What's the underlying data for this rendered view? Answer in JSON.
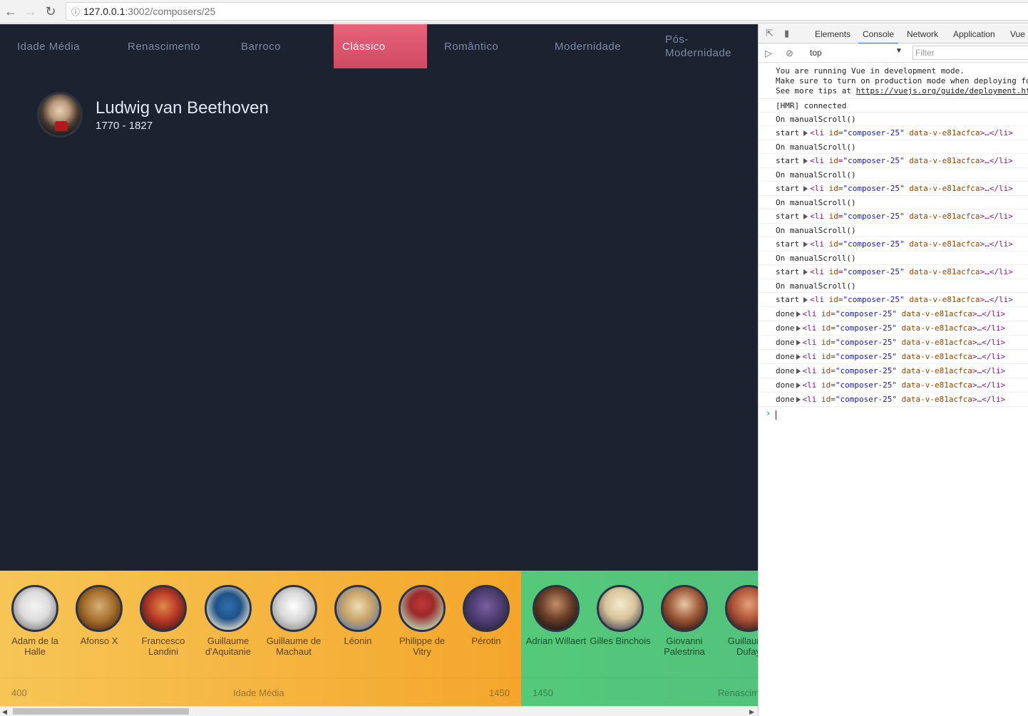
{
  "browser": {
    "url_host": "127.0.0.1",
    "url_path": ":3002/composers/25",
    "back_icon": "arrow-left-icon",
    "forward_icon": "arrow-right-icon",
    "reload_icon": "reload-icon",
    "info_icon": "info-icon"
  },
  "nav": {
    "periods": [
      {
        "label": "Idade Média"
      },
      {
        "label": "Renascimento"
      },
      {
        "label": "Barroco"
      },
      {
        "label": "Clássico",
        "active": true
      },
      {
        "label": "Romântico"
      },
      {
        "label": "Modernidade"
      },
      {
        "label": "Pós-Modernidade"
      }
    ],
    "active_color": "#d9566d"
  },
  "composer": {
    "name": "Ludwig van Beethoven",
    "years": "1770 - 1827"
  },
  "timeline": {
    "eras": [
      {
        "name": "Idade Média",
        "start": "400",
        "end": "1450",
        "color_from": "#f6c556",
        "color_to": "#f4a62b",
        "composers": [
          {
            "name": "Adam de la Halle"
          },
          {
            "name": "Afonso X"
          },
          {
            "name": "Francesco Landini"
          },
          {
            "name": "Guillaume d'Aquitanie"
          },
          {
            "name": "Guillaume de Machaut"
          },
          {
            "name": "Léonin"
          },
          {
            "name": "Philippe de Vitry"
          },
          {
            "name": "Pérotin"
          }
        ]
      },
      {
        "name": "Renascimento",
        "start": "1450",
        "color_from": "#55c97a",
        "color_to": "#53c27d",
        "composers": [
          {
            "name": "Adrian Willaert"
          },
          {
            "name": "Gilles Binchois"
          },
          {
            "name": "Giovanni Palestrina"
          },
          {
            "name": "Guillaume Dufay"
          }
        ]
      }
    ]
  },
  "devtools": {
    "tabs": [
      "Elements",
      "Console",
      "Network",
      "Application",
      "Vue"
    ],
    "active_tab": "Console",
    "context": "top",
    "filter_placeholder": "Filter",
    "messages": [
      {
        "type": "multiline",
        "lines": [
          "You are running Vue in development mode.",
          "Make sure to turn on production mode when deploying fo",
          "See more tips at "
        ],
        "link": "https://vuejs.org/guide/deployment.ht"
      },
      {
        "type": "text",
        "text": "[HMR] connected"
      },
      {
        "type": "text",
        "text": "On manualScroll()"
      },
      {
        "type": "el",
        "prefix": "start",
        "attr_id": "composer-25",
        "attr_data": "data-v-e81acfca"
      },
      {
        "type": "text",
        "text": "On manualScroll()"
      },
      {
        "type": "el",
        "prefix": "start",
        "attr_id": "composer-25",
        "attr_data": "data-v-e81acfca"
      },
      {
        "type": "text",
        "text": "On manualScroll()"
      },
      {
        "type": "el",
        "prefix": "start",
        "attr_id": "composer-25",
        "attr_data": "data-v-e81acfca"
      },
      {
        "type": "text",
        "text": "On manualScroll()"
      },
      {
        "type": "el",
        "prefix": "start",
        "attr_id": "composer-25",
        "attr_data": "data-v-e81acfca"
      },
      {
        "type": "text",
        "text": "On manualScroll()"
      },
      {
        "type": "el",
        "prefix": "start",
        "attr_id": "composer-25",
        "attr_data": "data-v-e81acfca"
      },
      {
        "type": "text",
        "text": "On manualScroll()"
      },
      {
        "type": "el",
        "prefix": "start",
        "attr_id": "composer-25",
        "attr_data": "data-v-e81acfca"
      },
      {
        "type": "text",
        "text": "On manualScroll()"
      },
      {
        "type": "el",
        "prefix": "start",
        "attr_id": "composer-25",
        "attr_data": "data-v-e81acfca"
      },
      {
        "type": "el",
        "prefix": "done",
        "attr_id": "composer-25",
        "attr_data": "data-v-e81acfca"
      },
      {
        "type": "el",
        "prefix": "done",
        "attr_id": "composer-25",
        "attr_data": "data-v-e81acfca"
      },
      {
        "type": "el",
        "prefix": "done",
        "attr_id": "composer-25",
        "attr_data": "data-v-e81acfca"
      },
      {
        "type": "el",
        "prefix": "done",
        "attr_id": "composer-25",
        "attr_data": "data-v-e81acfca"
      },
      {
        "type": "el",
        "prefix": "done",
        "attr_id": "composer-25",
        "attr_data": "data-v-e81acfca"
      },
      {
        "type": "el",
        "prefix": "done",
        "attr_id": "composer-25",
        "attr_data": "data-v-e81acfca"
      },
      {
        "type": "el",
        "prefix": "done",
        "attr_id": "composer-25",
        "attr_data": "data-v-e81acfca"
      }
    ]
  }
}
